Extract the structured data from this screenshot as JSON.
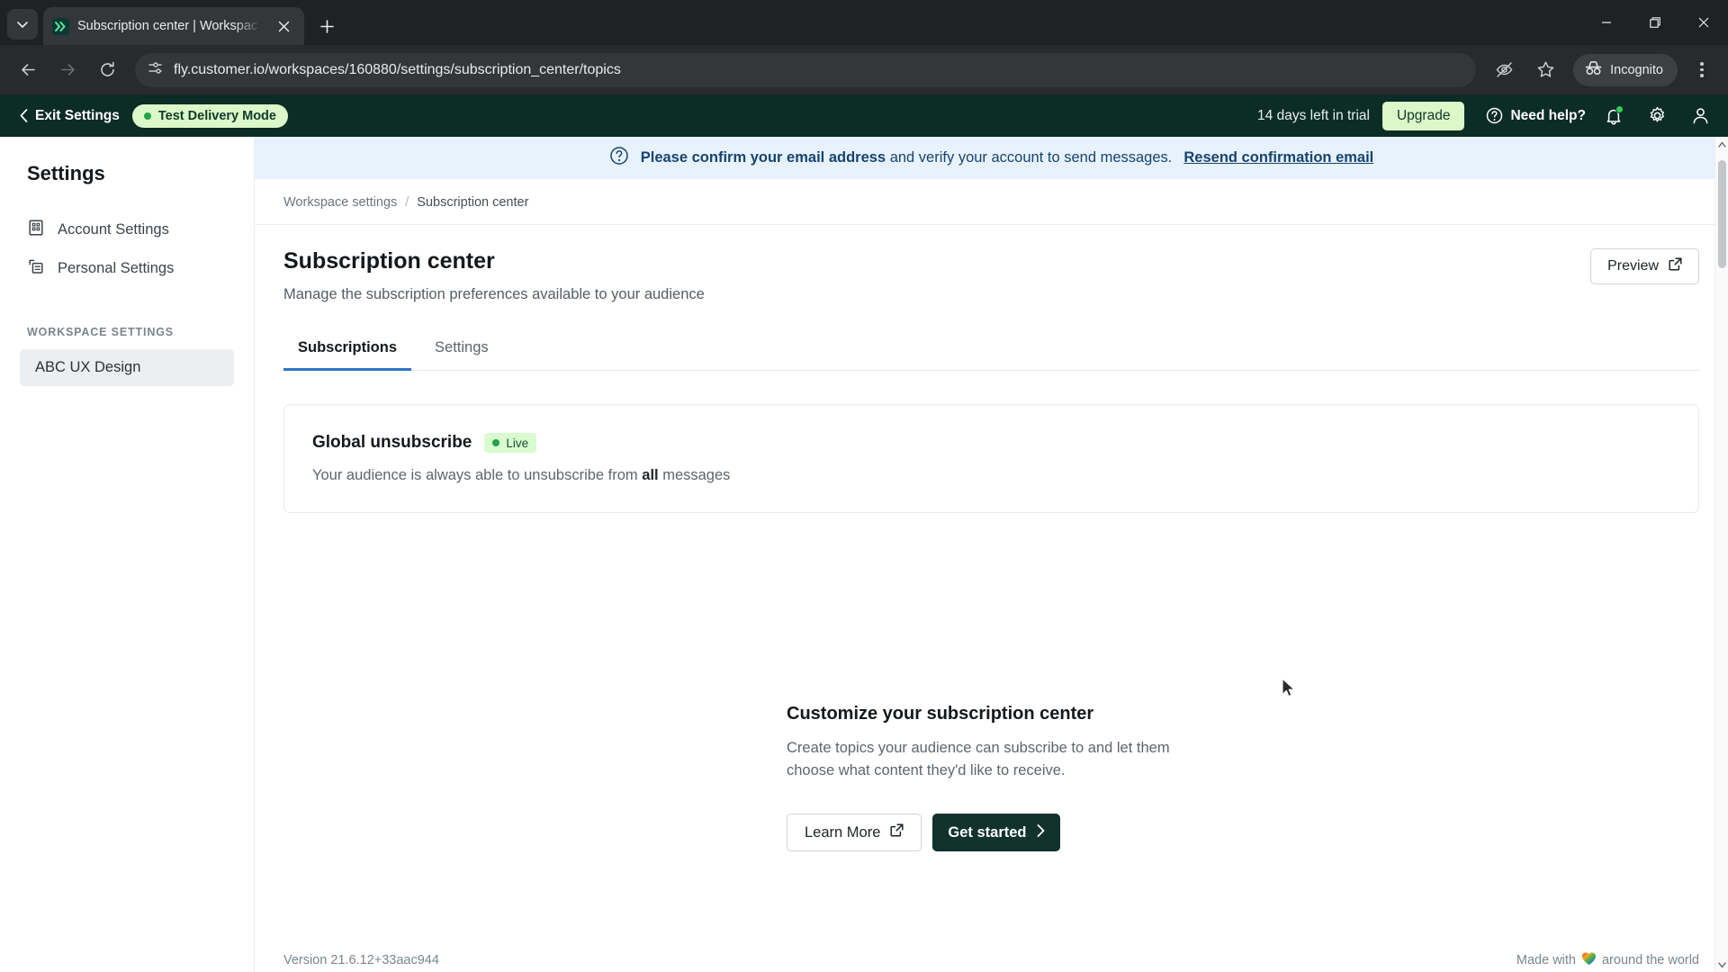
{
  "browser": {
    "tab": {
      "title": "Subscription center | Workspac",
      "favicon": "customerio-logo-icon"
    },
    "url": "fly.customer.io/workspaces/160880/settings/subscription_center/topics",
    "incognito_label": "Incognito"
  },
  "app_header": {
    "exit_settings": "Exit Settings",
    "test_delivery_mode": "Test Delivery Mode",
    "trial_text": "14 days left in trial",
    "upgrade_label": "Upgrade",
    "need_help": "Need help?"
  },
  "banner": {
    "bold": "Please confirm your email address",
    "rest": " and verify your account to send messages.",
    "link": "Resend confirmation email"
  },
  "sidebar": {
    "title": "Settings",
    "items": [
      {
        "label": "Account Settings",
        "icon": "building-icon"
      },
      {
        "label": "Personal Settings",
        "icon": "card-panel-icon"
      }
    ],
    "section_label": "WORKSPACE SETTINGS",
    "workspace": "ABC UX Design"
  },
  "breadcrumb": {
    "parent": "Workspace settings",
    "separator": "/",
    "current": "Subscription center"
  },
  "page": {
    "title": "Subscription center",
    "subtitle": "Manage the subscription preferences available to your audience",
    "preview_label": "Preview"
  },
  "tabs": [
    {
      "label": "Subscriptions",
      "active": true
    },
    {
      "label": "Settings",
      "active": false
    }
  ],
  "card": {
    "title": "Global unsubscribe",
    "status": "Live",
    "desc_before": "Your audience is always able to unsubscribe from ",
    "desc_bold": "all",
    "desc_after": " messages"
  },
  "empty_state": {
    "title": "Customize your subscription center",
    "desc": "Create topics your audience can subscribe to and let them choose what content they'd like to receive.",
    "learn_more": "Learn More",
    "get_started": "Get started"
  },
  "footer": {
    "version": "Version 21.6.12+33aac944",
    "made_with_before": "Made with",
    "made_with_after": "around the world"
  },
  "colors": {
    "header_bg": "#0c2c26",
    "accent_green": "#dcf7c8",
    "tab_active": "#2f73c4",
    "banner_bg": "#e8f2fd",
    "dark_button": "#11332c",
    "live_badge": "#d9fbd0"
  }
}
